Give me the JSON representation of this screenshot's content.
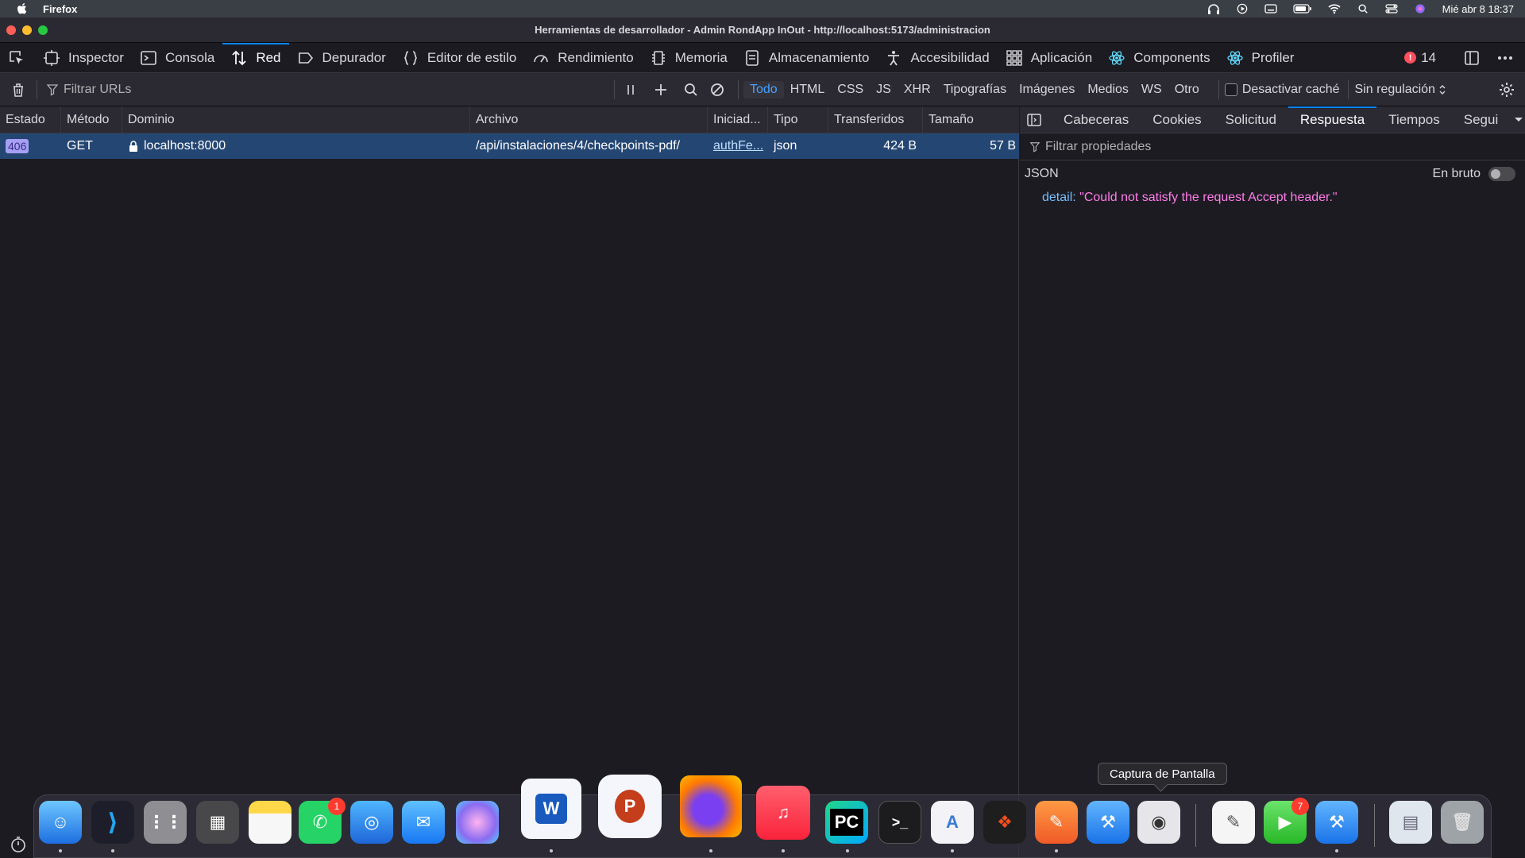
{
  "menubar": {
    "app_name": "Firefox",
    "clock": "Mié abr 8  18:37"
  },
  "window": {
    "title": "Herramientas de desarrollador - Admin RondApp InOut - http://localhost:5173/administracion"
  },
  "devtools_tabs": [
    {
      "label": "Inspector",
      "icon": "inspector-icon"
    },
    {
      "label": "Consola",
      "icon": "console-icon"
    },
    {
      "label": "Red",
      "icon": "network-icon",
      "active": true
    },
    {
      "label": "Depurador",
      "icon": "debugger-icon"
    },
    {
      "label": "Editor de estilo",
      "icon": "style-editor-icon"
    },
    {
      "label": "Rendimiento",
      "icon": "performance-icon"
    },
    {
      "label": "Memoria",
      "icon": "memory-icon"
    },
    {
      "label": "Almacenamiento",
      "icon": "storage-icon"
    },
    {
      "label": "Accesibilidad",
      "icon": "accessibility-icon"
    },
    {
      "label": "Aplicación",
      "icon": "application-icon"
    },
    {
      "label": "Components",
      "icon": "react-icon"
    },
    {
      "label": "Profiler",
      "icon": "react-profiler-icon"
    }
  ],
  "error_count": "14",
  "network_toolbar": {
    "filter_placeholder": "Filtrar URLs",
    "types": [
      "Todo",
      "HTML",
      "CSS",
      "JS",
      "XHR",
      "Tipografías",
      "Imágenes",
      "Medios",
      "WS",
      "Otro"
    ],
    "active_type": "Todo",
    "disable_cache_label": "Desactivar caché",
    "throttling_label": "Sin regulación"
  },
  "table": {
    "columns": [
      "Estado",
      "Método",
      "Dominio",
      "Archivo",
      "Iniciad...",
      "Tipo",
      "Transferidos",
      "Tamaño"
    ],
    "rows": [
      {
        "status": "406",
        "method": "GET",
        "domain": "localhost:8000",
        "file": "/api/instalaciones/4/checkpoints-pdf/",
        "initiator": "authFe...",
        "type": "json",
        "transferred": "424 B",
        "size": "57 B"
      }
    ]
  },
  "side_panel": {
    "tabs": [
      "Cabeceras",
      "Cookies",
      "Solicitud",
      "Respuesta",
      "Tiempos",
      "Segui"
    ],
    "active_tab": "Respuesta",
    "filter_placeholder": "Filtrar propiedades",
    "json_label": "JSON",
    "raw_label": "En bruto",
    "json_key": "detail:",
    "json_value": "\"Could not satisfy the request Accept header.\""
  },
  "dock": {
    "tooltip": "Captura de Pantalla",
    "whatsapp_badge": "1",
    "facetime_badge": "7"
  },
  "colors": {
    "accent": "#0a84ff",
    "selected_row": "#244673",
    "status_badge": "#a5a0f4"
  }
}
